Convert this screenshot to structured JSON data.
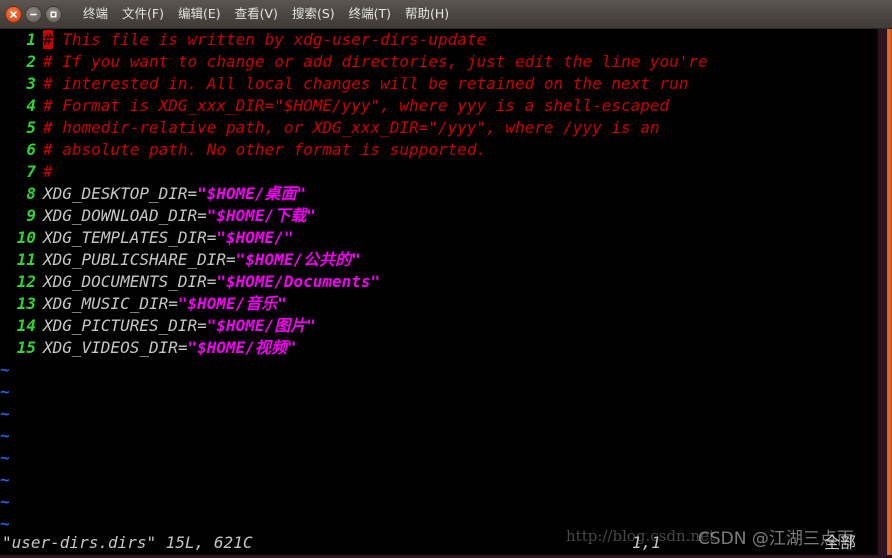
{
  "window": {
    "title": "终端",
    "controls": [
      {
        "name": "close",
        "glyph": "✕"
      },
      {
        "name": "minimize",
        "glyph": "–"
      },
      {
        "name": "maximize",
        "glyph": "□"
      }
    ]
  },
  "menubar": {
    "items": [
      {
        "label": "文件(F)",
        "name": "menu-file"
      },
      {
        "label": "编辑(E)",
        "name": "menu-edit"
      },
      {
        "label": "查看(V)",
        "name": "menu-view"
      },
      {
        "label": "搜索(S)",
        "name": "menu-search"
      },
      {
        "label": "终端(T)",
        "name": "menu-terminal"
      },
      {
        "label": "帮助(H)",
        "name": "menu-help"
      }
    ]
  },
  "editor": {
    "app": "vim",
    "cursor_char": "#",
    "colors": {
      "background": "#000000",
      "line_number": "#2fd62f",
      "comment": "#cc0000",
      "variable": "#c5c8c6",
      "string": "#f200f2",
      "tilde": "#1f5fe0",
      "cursor": "#cc0000"
    },
    "lines": [
      {
        "num": "1",
        "cursor": true,
        "cursor_text": "#",
        "parts": [
          {
            "cls": "comment",
            "text": " This file is written by xdg-user-dirs-update"
          }
        ]
      },
      {
        "num": "2",
        "parts": [
          {
            "cls": "comment",
            "text": "# If you want to change or add directories, just edit the line you're"
          }
        ]
      },
      {
        "num": "3",
        "parts": [
          {
            "cls": "comment",
            "text": "# interested in. All local changes will be retained on the next run"
          }
        ]
      },
      {
        "num": "4",
        "parts": [
          {
            "cls": "comment",
            "text": "# Format is XDG_xxx_DIR=\"$HOME/yyy\", where yyy is a shell-escaped"
          }
        ]
      },
      {
        "num": "5",
        "parts": [
          {
            "cls": "comment",
            "text": "# homedir-relative path, or XDG_xxx_DIR=\"/yyy\", where /yyy is an"
          }
        ]
      },
      {
        "num": "6",
        "parts": [
          {
            "cls": "comment",
            "text": "# absolute path. No other format is supported."
          }
        ]
      },
      {
        "num": "7",
        "parts": [
          {
            "cls": "comment",
            "text": "#"
          }
        ]
      },
      {
        "num": "8",
        "parts": [
          {
            "cls": "varname",
            "text": "XDG_DESKTOP_DIR="
          },
          {
            "cls": "strval",
            "text": "\"$HOME/桌面\""
          }
        ]
      },
      {
        "num": "9",
        "parts": [
          {
            "cls": "varname",
            "text": "XDG_DOWNLOAD_DIR="
          },
          {
            "cls": "strval",
            "text": "\"$HOME/下载\""
          }
        ]
      },
      {
        "num": "10",
        "parts": [
          {
            "cls": "varname",
            "text": "XDG_TEMPLATES_DIR="
          },
          {
            "cls": "strval",
            "text": "\"$HOME/\""
          }
        ]
      },
      {
        "num": "11",
        "parts": [
          {
            "cls": "varname",
            "text": "XDG_PUBLICSHARE_DIR="
          },
          {
            "cls": "strval",
            "text": "\"$HOME/公共的\""
          }
        ]
      },
      {
        "num": "12",
        "parts": [
          {
            "cls": "varname",
            "text": "XDG_DOCUMENTS_DIR="
          },
          {
            "cls": "strval",
            "text": "\"$HOME/Documents\""
          }
        ]
      },
      {
        "num": "13",
        "parts": [
          {
            "cls": "varname",
            "text": "XDG_MUSIC_DIR="
          },
          {
            "cls": "strval",
            "text": "\"$HOME/音乐\""
          }
        ]
      },
      {
        "num": "14",
        "parts": [
          {
            "cls": "varname",
            "text": "XDG_PICTURES_DIR="
          },
          {
            "cls": "strval",
            "text": "\"$HOME/图片\""
          }
        ]
      },
      {
        "num": "15",
        "parts": [
          {
            "cls": "varname",
            "text": "XDG_VIDEOS_DIR="
          },
          {
            "cls": "strval",
            "text": "\"$HOME/视频\""
          }
        ]
      }
    ],
    "empty_marker": "~",
    "empty_rows": 8
  },
  "status": {
    "file": "\"user-dirs.dirs\" 15L, 621C",
    "position": "1,1",
    "view": "全部"
  },
  "watermarks": {
    "url": "http://blog.csdn.net",
    "author": "CSDN @江湖三点雨"
  }
}
